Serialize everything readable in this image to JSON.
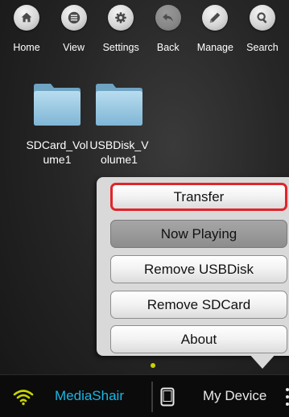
{
  "toolbar": {
    "items": [
      {
        "label": "Home",
        "icon": "home-icon"
      },
      {
        "label": "View",
        "icon": "list-icon"
      },
      {
        "label": "Settings",
        "icon": "gear-icon"
      },
      {
        "label": "Back",
        "icon": "back-arrow-icon"
      },
      {
        "label": "Manage",
        "icon": "pencil-icon"
      },
      {
        "label": "Search",
        "icon": "search-icon"
      }
    ]
  },
  "folders": [
    {
      "name": "SDCard_Volume1",
      "icon": "folder-icon"
    },
    {
      "name": "USBDisk_Volume1",
      "icon": "folder-icon"
    }
  ],
  "menu": {
    "items": [
      {
        "label": "Transfer",
        "state": "highlighted"
      },
      {
        "label": "Now Playing",
        "state": "pressed"
      },
      {
        "label": "Remove USBDisk",
        "state": "normal"
      },
      {
        "label": "Remove SDCard",
        "state": "normal"
      },
      {
        "label": "About",
        "state": "normal"
      }
    ]
  },
  "bottom_bar": {
    "tab1_label": "MediaShair",
    "tab1_icon": "wifi-icon",
    "tab2_label": "My Device",
    "tab2_icon": "phone-icon"
  },
  "colors": {
    "accent_blue": "#19b6e6",
    "highlight_red": "#e0252a",
    "page_dot": "#c8d400"
  }
}
